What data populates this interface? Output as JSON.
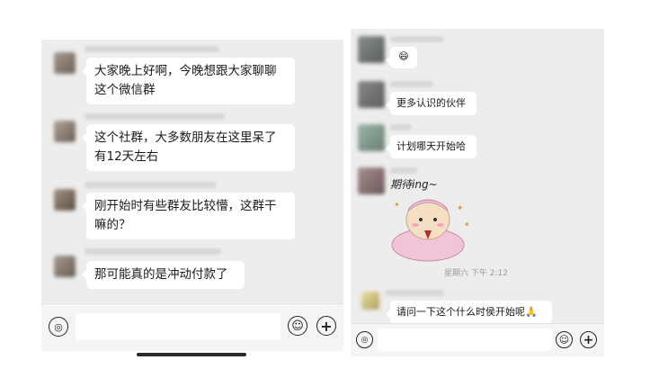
{
  "left_chat": {
    "messages": [
      {
        "text_line1": "大家晚上好啊，今晚想跟大家聊聊",
        "text_line2": "这个微信群"
      },
      {
        "text_line1": "这个社群，大多数朋友在这里呆了",
        "text_line2": "有12天左右"
      },
      {
        "text_line1": "刚开始时有些群友比较懵，这群干",
        "text_line2": "嘛的？"
      },
      {
        "text_line1": "那可能真的是冲动付款了"
      }
    ]
  },
  "right_chat": {
    "messages": [
      {
        "text": "😄"
      },
      {
        "text": "更多认识的伙伴"
      },
      {
        "text": "计划哪天开始哈"
      },
      {
        "sticker_caption": "期待ing~"
      },
      {
        "text": "请问一下这个什么时侯开始呢🙏"
      }
    ],
    "timestamp": "星期六 下午 2:12"
  },
  "icons": {
    "voice": "voice-icon",
    "emoji": "emoji-icon",
    "plus": "plus-icon"
  },
  "colors": {
    "chat_background": "#ededed",
    "bubble": "#ffffff",
    "sticker_skin": "#f5dfc4",
    "sticker_hat": "#f2c4d8"
  }
}
